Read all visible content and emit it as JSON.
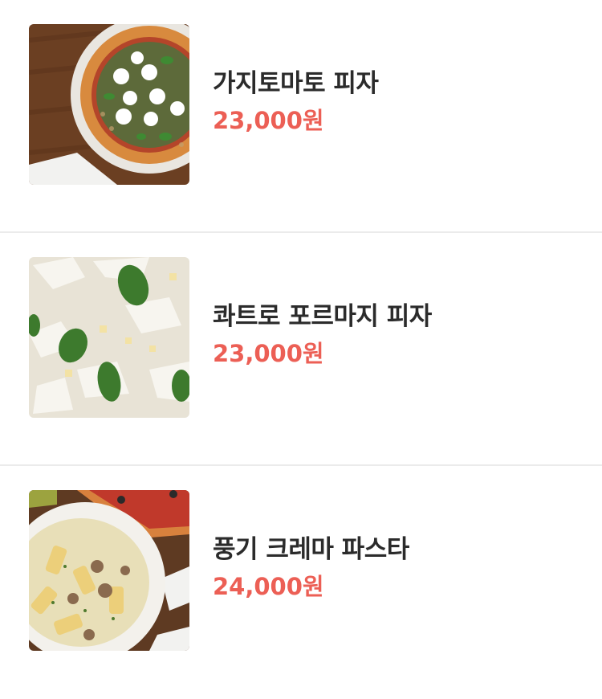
{
  "menu": {
    "items": [
      {
        "name": "가지토마토 피자",
        "price": "23,000원",
        "image": "eggplant-tomato-pizza-photo"
      },
      {
        "name": "콰트로 포르마지 피자",
        "price": "23,000원",
        "image": "quattro-formaggi-pizza-photo"
      },
      {
        "name": "풍기 크레마 파스타",
        "price": "24,000원",
        "image": "funghi-crema-pasta-photo"
      }
    ]
  },
  "colors": {
    "price": "#ec5f55",
    "name": "#2b2b2b",
    "divider": "#ebebeb"
  }
}
